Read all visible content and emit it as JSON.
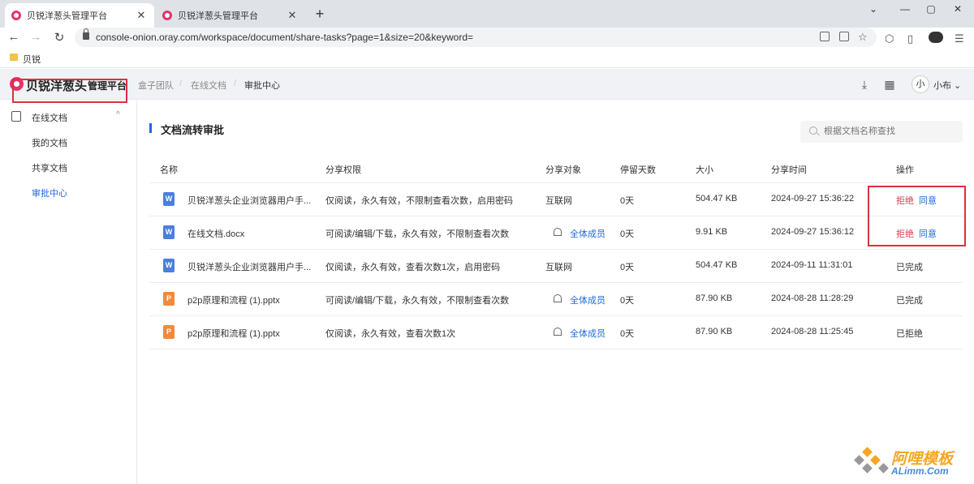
{
  "browser": {
    "tabs": [
      {
        "title": "贝锐洋葱头管理平台"
      },
      {
        "title": "贝锐洋葱头管理平台"
      }
    ],
    "url": "console-onion.oray.com/workspace/document/share-tasks?page=1&size=20&keyword=",
    "bookmark": "贝锐"
  },
  "header": {
    "logo_text": "贝锐洋葱头",
    "platform": "管理平台",
    "breadcrumb": [
      "盒子团队",
      "在线文档",
      "审批中心"
    ],
    "avatar": "小",
    "username": "小布"
  },
  "sidebar": {
    "group": "在线文档",
    "items": [
      {
        "label": "我的文档"
      },
      {
        "label": "共享文档"
      },
      {
        "label": "审批中心",
        "active": true
      }
    ]
  },
  "main": {
    "title": "文档流转审批",
    "search_placeholder": "根据文档名称查找",
    "columns": [
      "名称",
      "分享权限",
      "分享对象",
      "停留天数",
      "大小",
      "分享时间",
      "操作"
    ],
    "rows": [
      {
        "type": "word",
        "name": "贝锐洋葱头企业浏览器用户手...",
        "perm": "仅阅读，永久有效，不限制查看次数，启用密码",
        "target": "互联网",
        "team": false,
        "days": "0天",
        "size": "504.47 KB",
        "time": "2024-09-27 15:36:22",
        "reject": "拒绝",
        "agree": "同意"
      },
      {
        "type": "word",
        "name": "在线文档.docx",
        "perm": "可阅读/编辑/下载，永久有效，不限制查看次数",
        "target": "全体成员",
        "team": true,
        "days": "0天",
        "size": "9.91 KB",
        "time": "2024-09-27 15:36:12",
        "reject": "拒绝",
        "agree": "同意"
      },
      {
        "type": "word",
        "name": "贝锐洋葱头企业浏览器用户手...",
        "perm": "仅阅读，永久有效，查看次数1次，启用密码",
        "target": "互联网",
        "team": false,
        "days": "0天",
        "size": "504.47 KB",
        "time": "2024-09-11 11:31:01",
        "status": "已完成"
      },
      {
        "type": "ppt",
        "name": "p2p原理和流程 (1).pptx",
        "perm": "可阅读/编辑/下载，永久有效，不限制查看次数",
        "target": "全体成员",
        "team": true,
        "days": "0天",
        "size": "87.90 KB",
        "time": "2024-08-28 11:28:29",
        "status": "已完成"
      },
      {
        "type": "ppt",
        "name": "p2p原理和流程 (1).pptx",
        "perm": "仅阅读，永久有效，查看次数1次",
        "target": "全体成员",
        "team": true,
        "days": "0天",
        "size": "87.90 KB",
        "time": "2024-08-28 11:25:45",
        "status": "已拒绝"
      }
    ],
    "file_icon_letters": {
      "word": "W",
      "ppt": "P"
    }
  },
  "watermark": {
    "text": "阿哩模板",
    "sub": "ALimm.Com"
  },
  "colors": {
    "brand": "#e5326b",
    "link": "#1e6ad8",
    "reject": "#e0384e",
    "highlight": "#d9323f"
  },
  "icons": {
    "download": "download-icon",
    "apps": "apps-grid-icon"
  }
}
